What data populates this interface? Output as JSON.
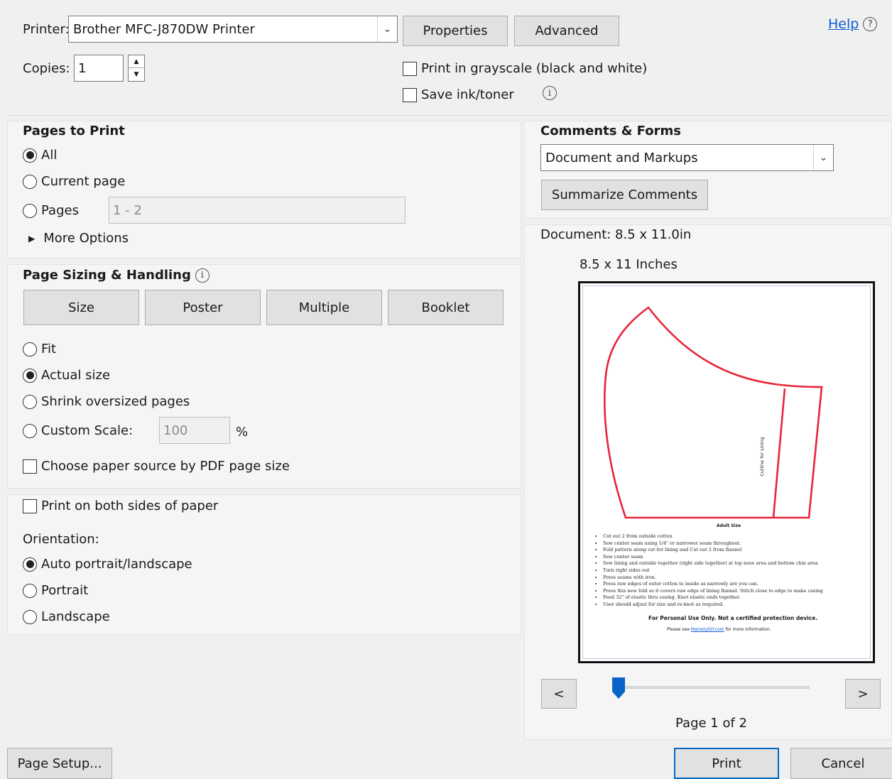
{
  "printer": {
    "label": "Printer:",
    "selected": "Brother MFC-J870DW Printer",
    "properties_label": "Properties",
    "advanced_label": "Advanced",
    "help_label": "Help"
  },
  "copies": {
    "label": "Copies:",
    "value": "1"
  },
  "options": {
    "grayscale_label": "Print in grayscale (black and white)",
    "save_ink_label": "Save ink/toner"
  },
  "pages_to_print": {
    "title": "Pages to Print",
    "all_label": "All",
    "current_label": "Current page",
    "pages_label": "Pages",
    "pages_value": "1 - 2",
    "more_options_label": "More Options",
    "selected": "All"
  },
  "page_sizing": {
    "title": "Page Sizing & Handling",
    "tabs": [
      "Size",
      "Poster",
      "Multiple",
      "Booklet"
    ],
    "fit_label": "Fit",
    "actual_label": "Actual size",
    "shrink_label": "Shrink oversized pages",
    "custom_label": "Custom Scale:",
    "custom_value": "100",
    "percent": "%",
    "paper_source_label": "Choose paper source by PDF page size",
    "selected": "Actual size"
  },
  "duplex": {
    "label": "Print on both sides of paper"
  },
  "orientation": {
    "title": "Orientation:",
    "auto_label": "Auto portrait/landscape",
    "portrait_label": "Portrait",
    "landscape_label": "Landscape",
    "selected": "Auto portrait/landscape"
  },
  "comments_forms": {
    "title": "Comments & Forms",
    "selected": "Document and Markups",
    "summarize_label": "Summarize Comments"
  },
  "preview": {
    "document_size": "Document: 8.5 x 11.0in",
    "paper_size": "8.5 x 11 Inches",
    "page_indicator": "Page 1 of 2",
    "prev_label": "<",
    "next_label": ">",
    "slider_fraction": 0.0,
    "page": {
      "cutline_label": "Cutline for Lining",
      "size_label": "Adult Size",
      "bullets": [
        "Cut out 2 from outside cotton",
        "Sew center seam using 1/4\" or narrower seam throughout.",
        "Fold pattern along cut for lining and Cut out 2 from flannel",
        "Sew center seam",
        "Sew lining and outside together (right side together) at top nose area and bottom chin area",
        "Turn right sides out",
        "Press seams with iron.",
        "Press raw edges of outer cotton to inside as narrowly are you can.",
        "Press this new fold so it covers raw edge of lining flannel. Stitch close to edge to make casing",
        "Feed 32\" of elastic thru casing. Knot elastic ends together.",
        "User should adjust for size and re-knot as required."
      ],
      "personal_use": "For Personal Use Only. Not a certified protection device.",
      "more_info_prefix": "Please see",
      "more_info_link": "MainelyDIY.com",
      "more_info_suffix": "for more information."
    }
  },
  "footer": {
    "page_setup_label": "Page Setup...",
    "print_label": "Print",
    "cancel_label": "Cancel"
  },
  "colors": {
    "pattern_line": "#e8243a",
    "link": "#0b5cd6",
    "primary_border": "#0067c0",
    "slider_thumb": "#0a64c8"
  }
}
